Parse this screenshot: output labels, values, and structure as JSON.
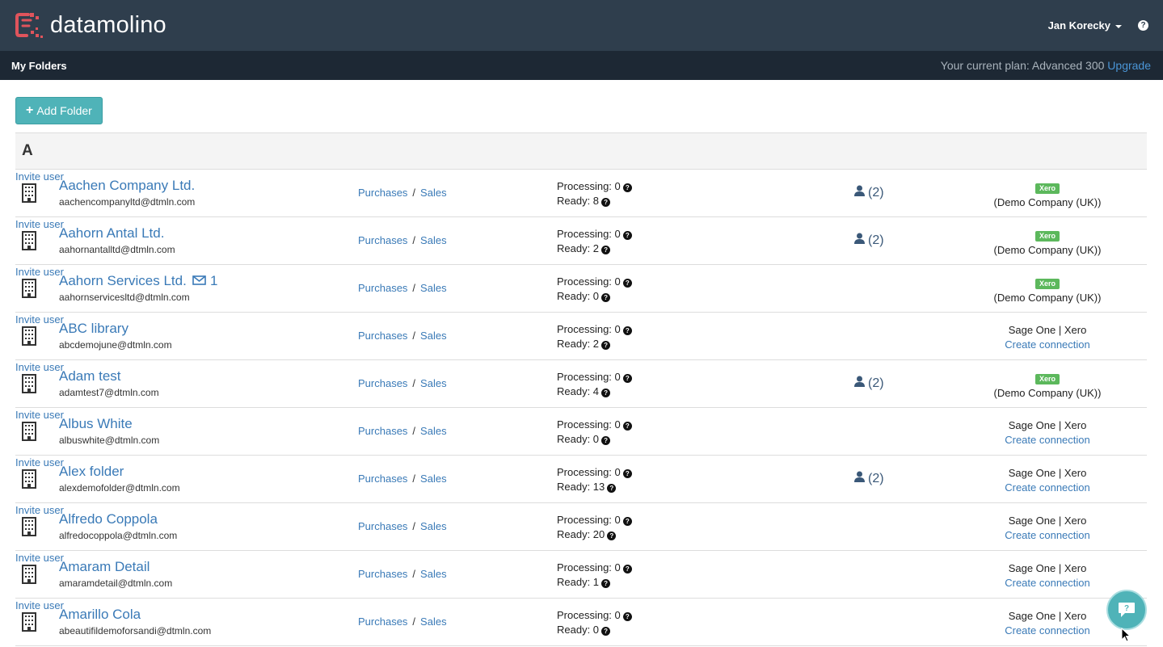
{
  "app": {
    "brand": "datamolino"
  },
  "header": {
    "user_name": "Jan Korecky",
    "help_icon": "question-circle-icon"
  },
  "subheader": {
    "title": "My Folders",
    "plan_text": "Your current plan: Advanced 300",
    "upgrade_label": "Upgrade"
  },
  "toolbar": {
    "add_folder_label": "Add Folder"
  },
  "group": {
    "letter": "A"
  },
  "folders": [
    {
      "name": "Aachen Company Ltd.",
      "email": "aachencompanyltd@dtmln.com",
      "purchases": "Purchases",
      "sales": "Sales",
      "processing": "Processing: 0",
      "ready": "Ready: 8",
      "invite": "Invite user",
      "users": "(2)",
      "badge": "Xero",
      "company": "(Demo Company (UK))"
    },
    {
      "name": "Aahorn Antal Ltd.",
      "email": "aahornantalltd@dtmln.com",
      "purchases": "Purchases",
      "sales": "Sales",
      "processing": "Processing: 0",
      "ready": "Ready: 2",
      "invite": "Invite user",
      "users": "(2)",
      "badge": "Xero",
      "company": "(Demo Company (UK))"
    },
    {
      "name": "Aahorn Services Ltd.",
      "email": "aahornservicesltd@dtmln.com",
      "messages": "1",
      "purchases": "Purchases",
      "sales": "Sales",
      "processing": "Processing: 0",
      "ready": "Ready: 0",
      "invite": "Invite user",
      "badge": "Xero",
      "company": "(Demo Company (UK))"
    },
    {
      "name": "ABC library",
      "email": "abcdemojune@dtmln.com",
      "purchases": "Purchases",
      "sales": "Sales",
      "processing": "Processing: 0",
      "ready": "Ready: 2",
      "invite": "Invite user",
      "services": "Sage One | Xero",
      "create": "Create connection"
    },
    {
      "name": "Adam test",
      "email": "adamtest7@dtmln.com",
      "purchases": "Purchases",
      "sales": "Sales",
      "processing": "Processing: 0",
      "ready": "Ready: 4",
      "invite": "Invite user",
      "users": "(2)",
      "badge": "Xero",
      "company": "(Demo Company (UK))"
    },
    {
      "name": "Albus White",
      "email": "albuswhite@dtmln.com",
      "purchases": "Purchases",
      "sales": "Sales",
      "processing": "Processing: 0",
      "ready": "Ready: 0",
      "invite": "Invite user",
      "services": "Sage One | Xero",
      "create": "Create connection"
    },
    {
      "name": "Alex folder",
      "email": "alexdemofolder@dtmln.com",
      "purchases": "Purchases",
      "sales": "Sales",
      "processing": "Processing: 0",
      "ready": "Ready: 13",
      "invite": "Invite user",
      "users": "(2)",
      "services": "Sage One | Xero",
      "create": "Create connection"
    },
    {
      "name": "Alfredo Coppola",
      "email": "alfredocoppola@dtmln.com",
      "purchases": "Purchases",
      "sales": "Sales",
      "processing": "Processing: 0",
      "ready": "Ready: 20",
      "invite": "Invite user",
      "services": "Sage One | Xero",
      "create": "Create connection"
    },
    {
      "name": "Amaram Detail",
      "email": "amaramdetail@dtmln.com",
      "purchases": "Purchases",
      "sales": "Sales",
      "processing": "Processing: 0",
      "ready": "Ready: 1",
      "invite": "Invite user",
      "services": "Sage One | Xero",
      "create": "Create connection"
    },
    {
      "name": "Amarillo Cola",
      "email": "abeautifildemoforsandi@dtmln.com",
      "purchases": "Purchases",
      "sales": "Sales",
      "processing": "Processing: 0",
      "ready": "Ready: 0",
      "invite": "Invite user",
      "services": "Sage One | Xero",
      "create": "Create connection"
    }
  ],
  "colors": {
    "topbar": "#2f3e4d",
    "subbar": "#1d2834",
    "accent": "#4fb3b8",
    "link": "#3a7ab7",
    "xero_badge": "#5cb85c",
    "logo": "#e0545c"
  }
}
